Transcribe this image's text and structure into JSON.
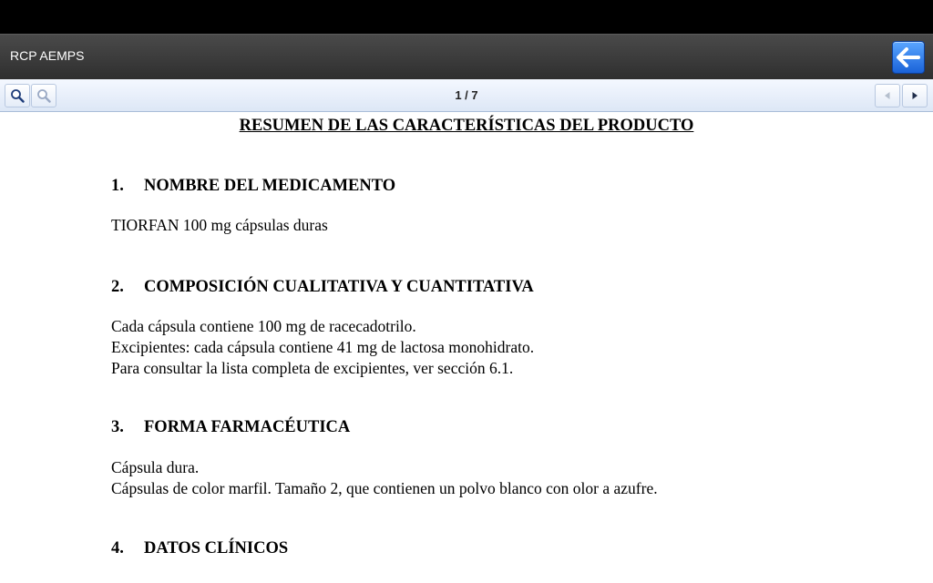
{
  "app": {
    "title": "RCP AEMPS"
  },
  "toolbar": {
    "page_indicator": "1 / 7",
    "zoom_in_icon": "zoom-in-icon",
    "zoom_out_icon": "zoom-out-icon",
    "prev_icon": "triangle-left-icon",
    "next_icon": "triangle-right-icon"
  },
  "document": {
    "title": "RESUMEN DE LAS CARACTERÍSTICAS DEL PRODUCTO",
    "sections": [
      {
        "number": "1.",
        "heading": "NOMBRE DEL MEDICAMENTO",
        "lines": [
          "TIORFAN 100 mg cápsulas duras"
        ]
      },
      {
        "number": "2.",
        "heading": "COMPOSICIÓN CUALITATIVA Y CUANTITATIVA",
        "lines": [
          "Cada cápsula contiene 100 mg de racecadotrilo.",
          "Excipientes: cada cápsula contiene 41 mg de lactosa monohidrato.",
          "Para consultar la lista completa de excipientes, ver sección 6.1."
        ]
      },
      {
        "number": "3.",
        "heading": "FORMA FARMACÉUTICA",
        "lines": [
          "Cápsula dura.",
          "Cápsulas de color marfil. Tamaño 2, que contienen un polvo blanco con olor a azufre."
        ]
      },
      {
        "number": "4.",
        "heading": "DATOS CLÍNICOS",
        "lines": []
      }
    ]
  },
  "colors": {
    "title_bar": "#3a3a3a",
    "back_button": "#2a7af0",
    "toolbar": "#e6eef9"
  }
}
